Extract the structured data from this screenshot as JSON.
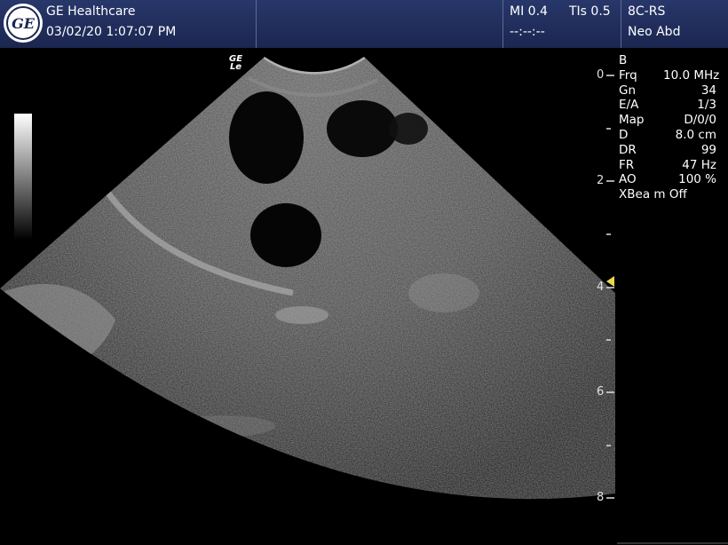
{
  "header": {
    "brand": "GE Healthcare",
    "datetime": "03/02/20 1:07:07 PM",
    "mi": "MI 0.4",
    "tis": "TIs 0.5",
    "probe": "8C-RS",
    "exam_timer": "--:--:--",
    "preset": "Neo Abd",
    "logo_letters": "GE"
  },
  "image": {
    "probe_orientation_mark_top": "GE",
    "probe_orientation_mark_bottom": "Le",
    "depth_scale_labels": [
      "0",
      "2",
      "4",
      "6",
      "8"
    ],
    "depth_unit": "cm",
    "max_depth_cm": 8.0,
    "focus_depth_cm": 3.9,
    "focus_marker_color": "#e8d84c"
  },
  "params": {
    "mode": "B",
    "rows": [
      {
        "label": "Frq",
        "value": "10.0 MHz"
      },
      {
        "label": "Gn",
        "value": "34"
      },
      {
        "label": "E/A",
        "value": "1/3"
      },
      {
        "label": "Map",
        "value": "D/0/0"
      },
      {
        "label": "D",
        "value": "8.0 cm"
      },
      {
        "label": "DR",
        "value": "99"
      },
      {
        "label": "FR",
        "value": "47 Hz"
      },
      {
        "label": "AO",
        "value": "100 %"
      }
    ],
    "xbeam": "XBea m Off"
  },
  "colors": {
    "header_bg": "#1b2650",
    "accent_yellow": "#e8d84c"
  }
}
